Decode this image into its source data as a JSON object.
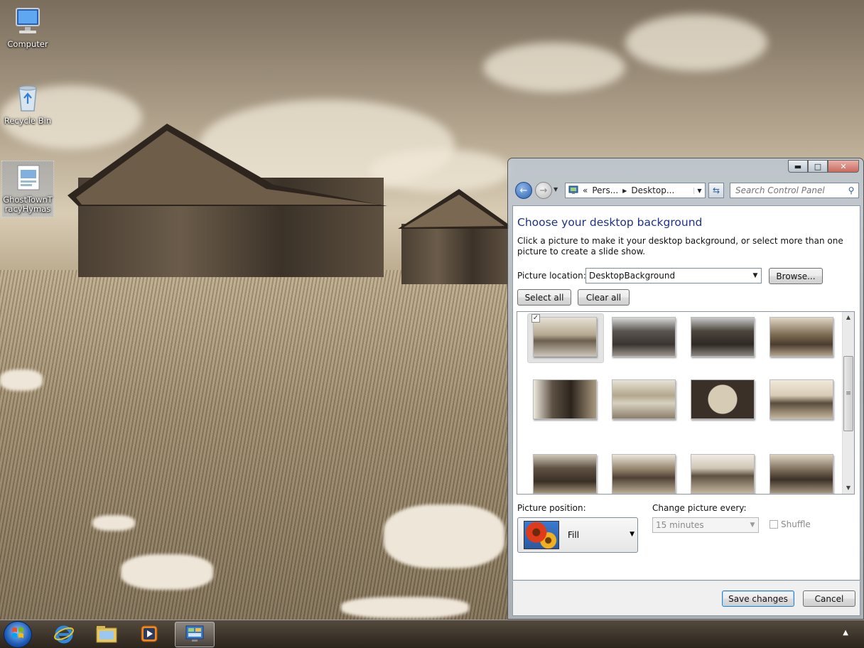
{
  "desktop": {
    "icons": [
      {
        "label": "Computer"
      },
      {
        "label": "Recycle Bin"
      },
      {
        "label": "GhostTownTracyHymas"
      }
    ]
  },
  "window": {
    "address": {
      "prefix": "«",
      "crumb1": "Pers...",
      "crumb2": "Desktop..."
    },
    "search": {
      "placeholder": "Search Control Panel"
    },
    "title": "Choose your desktop background",
    "description": "Click a picture to make it your desktop background, or select more than one picture to create a slide show.",
    "picture_location": {
      "label": "Picture location:",
      "value": "DesktopBackground"
    },
    "browse_label": "Browse...",
    "select_all_label": "Select all",
    "clear_all_label": "Clear all",
    "thumbnails": [
      {
        "checked": true
      },
      {
        "checked": false
      },
      {
        "checked": false
      },
      {
        "checked": false
      },
      {
        "checked": false
      },
      {
        "checked": false
      },
      {
        "checked": false
      },
      {
        "checked": false
      },
      {
        "checked": false
      },
      {
        "checked": false
      },
      {
        "checked": false
      },
      {
        "checked": false
      }
    ],
    "picture_position": {
      "label": "Picture position:",
      "value": "Fill"
    },
    "change_every": {
      "label": "Change picture every:",
      "value": "15 minutes"
    },
    "shuffle_label": "Shuffle",
    "save_label": "Save changes",
    "cancel_label": "Cancel"
  },
  "taskbar": {
    "items": [
      "start",
      "internet-explorer",
      "windows-explorer",
      "media-player",
      "control-panel"
    ],
    "active": "control-panel"
  },
  "colors": {
    "title_blue": "#1e3287",
    "start_blue": "#1e5cb6"
  }
}
